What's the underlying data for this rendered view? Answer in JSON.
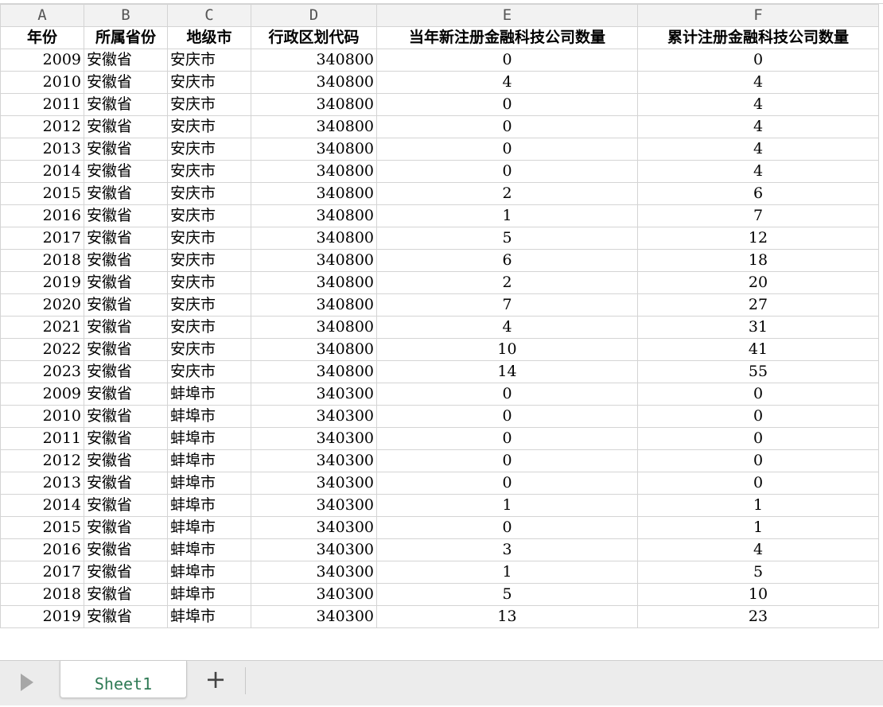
{
  "columns": [
    "A",
    "B",
    "C",
    "D",
    "E",
    "F"
  ],
  "headers": [
    "年份",
    "所属省份",
    "地级市",
    "行政区划代码",
    "当年新注册金融科技公司数量",
    "累计注册金融科技公司数量"
  ],
  "rows": [
    [
      "2009",
      "安徽省",
      "安庆市",
      "340800",
      "0",
      "0"
    ],
    [
      "2010",
      "安徽省",
      "安庆市",
      "340800",
      "4",
      "4"
    ],
    [
      "2011",
      "安徽省",
      "安庆市",
      "340800",
      "0",
      "4"
    ],
    [
      "2012",
      "安徽省",
      "安庆市",
      "340800",
      "0",
      "4"
    ],
    [
      "2013",
      "安徽省",
      "安庆市",
      "340800",
      "0",
      "4"
    ],
    [
      "2014",
      "安徽省",
      "安庆市",
      "340800",
      "0",
      "4"
    ],
    [
      "2015",
      "安徽省",
      "安庆市",
      "340800",
      "2",
      "6"
    ],
    [
      "2016",
      "安徽省",
      "安庆市",
      "340800",
      "1",
      "7"
    ],
    [
      "2017",
      "安徽省",
      "安庆市",
      "340800",
      "5",
      "12"
    ],
    [
      "2018",
      "安徽省",
      "安庆市",
      "340800",
      "6",
      "18"
    ],
    [
      "2019",
      "安徽省",
      "安庆市",
      "340800",
      "2",
      "20"
    ],
    [
      "2020",
      "安徽省",
      "安庆市",
      "340800",
      "7",
      "27"
    ],
    [
      "2021",
      "安徽省",
      "安庆市",
      "340800",
      "4",
      "31"
    ],
    [
      "2022",
      "安徽省",
      "安庆市",
      "340800",
      "10",
      "41"
    ],
    [
      "2023",
      "安徽省",
      "安庆市",
      "340800",
      "14",
      "55"
    ],
    [
      "2009",
      "安徽省",
      "蚌埠市",
      "340300",
      "0",
      "0"
    ],
    [
      "2010",
      "安徽省",
      "蚌埠市",
      "340300",
      "0",
      "0"
    ],
    [
      "2011",
      "安徽省",
      "蚌埠市",
      "340300",
      "0",
      "0"
    ],
    [
      "2012",
      "安徽省",
      "蚌埠市",
      "340300",
      "0",
      "0"
    ],
    [
      "2013",
      "安徽省",
      "蚌埠市",
      "340300",
      "0",
      "0"
    ],
    [
      "2014",
      "安徽省",
      "蚌埠市",
      "340300",
      "1",
      "1"
    ],
    [
      "2015",
      "安徽省",
      "蚌埠市",
      "340300",
      "0",
      "1"
    ],
    [
      "2016",
      "安徽省",
      "蚌埠市",
      "340300",
      "3",
      "4"
    ],
    [
      "2017",
      "安徽省",
      "蚌埠市",
      "340300",
      "1",
      "5"
    ],
    [
      "2018",
      "安徽省",
      "蚌埠市",
      "340300",
      "5",
      "10"
    ],
    [
      "2019",
      "安徽省",
      "蚌埠市",
      "340300",
      "13",
      "23"
    ]
  ],
  "tabs": {
    "nav_icon": "play-triangle-icon",
    "sheet_name": "Sheet1",
    "add_label": "+",
    "add_icon": "plus-icon"
  }
}
